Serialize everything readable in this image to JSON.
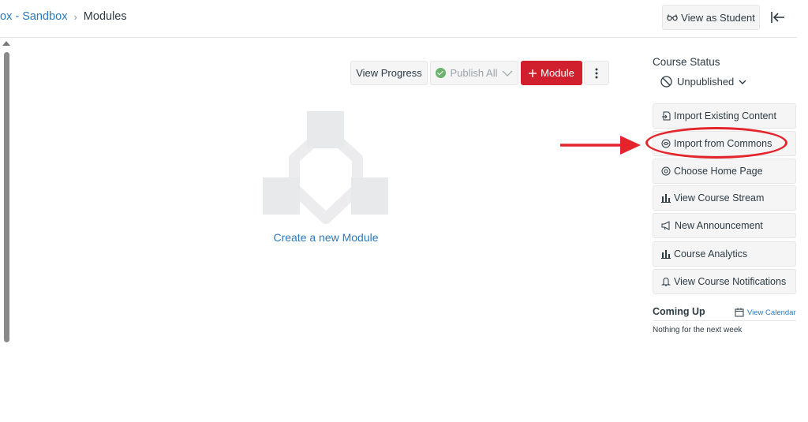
{
  "breadcrumb": {
    "course": "ox - Sandbox",
    "current": "Modules"
  },
  "header": {
    "view_as_student": "View as Student"
  },
  "toolbar": {
    "view_progress": "View Progress",
    "publish_all": "Publish All",
    "module": "Module"
  },
  "empty_state": {
    "create_link": "Create a new Module"
  },
  "sidebar": {
    "course_status_label": "Course Status",
    "status_value": "Unpublished",
    "items": [
      {
        "label": "Import Existing Content",
        "icon": "import-icon"
      },
      {
        "label": "Import from Commons",
        "icon": "commons-icon"
      },
      {
        "label": "Choose Home Page",
        "icon": "target-icon"
      },
      {
        "label": "View Course Stream",
        "icon": "bar-chart-icon"
      },
      {
        "label": "New Announcement",
        "icon": "megaphone-icon"
      },
      {
        "label": "Course Analytics",
        "icon": "bar-chart-icon"
      },
      {
        "label": "View Course Notifications",
        "icon": "bell-icon"
      }
    ],
    "coming_up": "Coming Up",
    "view_calendar": "View Calendar",
    "nothing": "Nothing for the next week"
  },
  "colors": {
    "accent": "#2b7abc",
    "brand_red": "#d0202e",
    "annotation_red": "#e3242b",
    "success_green": "#6cb46d"
  }
}
